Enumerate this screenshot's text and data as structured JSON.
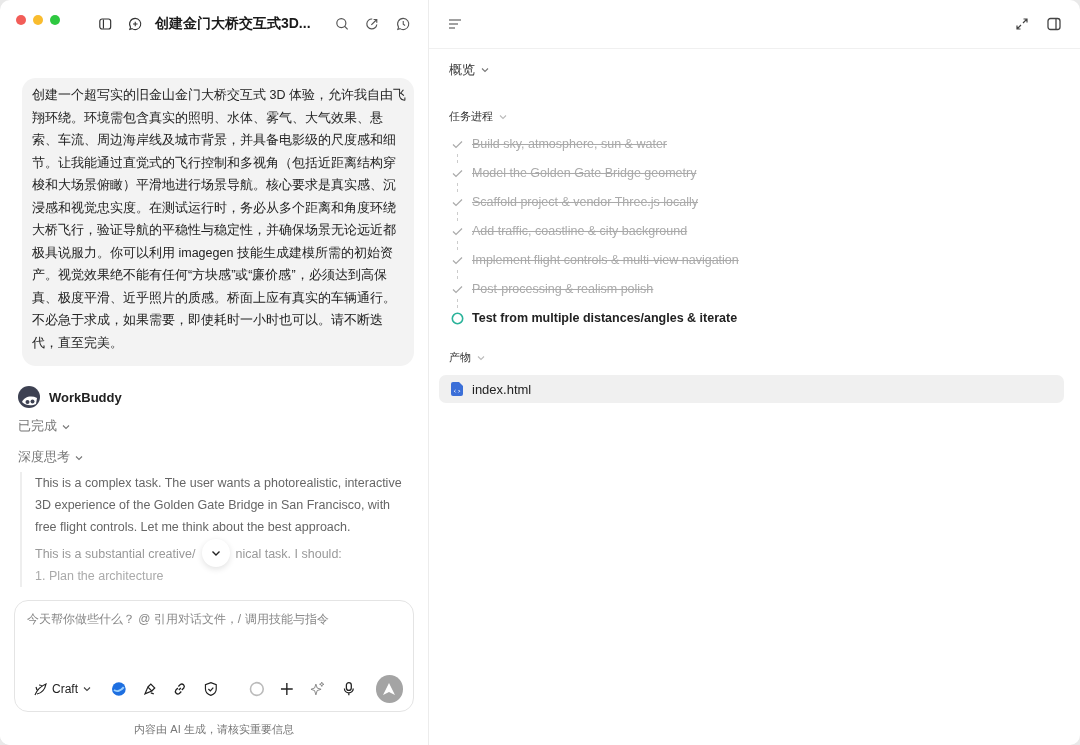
{
  "window": {
    "title": "创建金门大桥交互式3D..."
  },
  "chat": {
    "user_message": "创建一个超写实的旧金山金门大桥交互式 3D 体验，允许我自由飞翔环绕。环境需包含真实的照明、水体、雾气、大气效果、悬索、车流、周边海岸线及城市背景，并具备电影级的尺度感和细节。让我能通过直觉式的飞行控制和多视角（包括近距离结构穿梭和大场景俯瞰）平滑地进行场景导航。核心要求是真实感、沉浸感和视觉忠实度。在测试运行时，务必从多个距离和角度环绕大桥飞行，验证导航的平稳性与稳定性，并确保场景无论远近都极具说服力。你可以利用 imagegen 技能生成建模所需的初始资产。视觉效果绝不能有任何“方块感”或“廉价感”，必须达到高保真、极度平滑、近乎照片的质感。桥面上应有真实的车辆通行。不必急于求成，如果需要，即使耗时一小时也可以。请不断迭代，直至完美。",
    "assistant_name": "WorkBuddy",
    "status": {
      "label": "已完成",
      "expanded": false
    },
    "thinking": {
      "label": "深度思考",
      "expanded": true,
      "paragraph": "This is a complex task. The user wants a photorealistic, interactive 3D experience of the Golden Gate Bridge in San Francisco, with free flight controls. Let me think about the best approach.",
      "line_before_button": "This is a substantial creative/",
      "line_after_button": "nical task. I should:",
      "list_item": "1. Plan the architecture"
    }
  },
  "composer": {
    "placeholder": "今天帮你做些什么？ @ 引用对话文件，/ 调用技能与指令",
    "mode": "Craft",
    "disclaimer": "内容由 AI 生成，请核实重要信息"
  },
  "panel": {
    "overview": "概览",
    "progress_title": "任务进程",
    "tasks": [
      {
        "label": "Build sky, atmosphere, sun & water",
        "done": true
      },
      {
        "label": "Model the Golden Gate Bridge geometry",
        "done": true
      },
      {
        "label": "Scaffold project & vendor Three.js locally",
        "done": true
      },
      {
        "label": "Add traffic, coastline & city background",
        "done": true
      },
      {
        "label": "Implement flight controls & multi-view navigation",
        "done": true
      },
      {
        "label": "Post-processing & realism polish",
        "done": true
      },
      {
        "label": "Test from multiple distances/angles & iterate",
        "done": false
      }
    ],
    "artifacts_title": "产物",
    "artifacts": [
      {
        "name": "index.html",
        "selected": true
      }
    ]
  }
}
